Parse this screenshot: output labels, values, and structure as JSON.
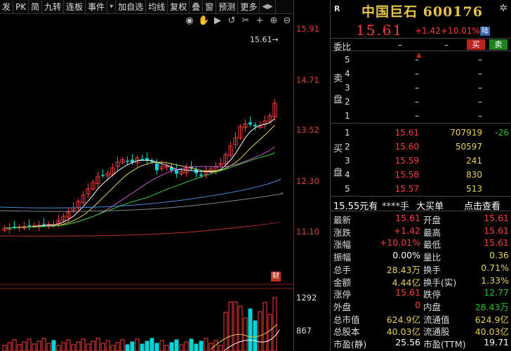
{
  "toolbar": {
    "items": [
      "发",
      "PK",
      "简",
      "九转",
      "连板",
      "事件",
      "▾",
      "加自选",
      "均线",
      "复权",
      "叠",
      "窗",
      "预测",
      "更多",
      "◀▶"
    ]
  },
  "chart": {
    "price_axis": [
      "15.91",
      "14.71",
      "13.52",
      "12.30",
      "11.10"
    ],
    "current_price_marker": "15.61→",
    "volume_axis": [
      "1292",
      "867"
    ],
    "marker_badge": "财",
    "tool_icons": [
      "eye-icon",
      "hand-icon",
      "play-icon",
      "undo-icon",
      "scissors-icon",
      "plus-icon",
      "zoom-in-icon",
      "zoom-out-icon"
    ],
    "colors": {
      "up": "#ff3b3b",
      "down": "#00d4d4",
      "ma5": "#ffffff",
      "ma10": "#e6d24a",
      "ma20": "#cc55cc",
      "ma30": "#33cc33",
      "ma60": "#4a8ad8",
      "ma120": "#888888",
      "ma250": "#c03030"
    }
  },
  "quote": {
    "badge": "R",
    "title": "中国巨石 600176",
    "price": "15.61",
    "change": "+1.42",
    "change_pct": "+10.01%",
    "exchange_badge": "陆"
  },
  "weibi": {
    "label": "委比",
    "v1": "–",
    "v2": "–",
    "buy": "买",
    "sell": "卖",
    "collapse": "▲"
  },
  "asks": {
    "label": [
      "卖",
      "盘"
    ],
    "rows": [
      {
        "level": "5",
        "price": "–",
        "vol": "–"
      },
      {
        "level": "4",
        "price": "–",
        "vol": "–"
      },
      {
        "level": "3",
        "price": "–",
        "vol": "–"
      },
      {
        "level": "2",
        "price": "–",
        "vol": "–"
      },
      {
        "level": "1",
        "price": "–",
        "vol": "–"
      }
    ]
  },
  "bids": {
    "label": [
      "买",
      "盘"
    ],
    "rows": [
      {
        "level": "1",
        "price": "15.61",
        "vol": "707919",
        "extra": "-26"
      },
      {
        "level": "2",
        "price": "15.60",
        "vol": "50597",
        "extra": ""
      },
      {
        "level": "3",
        "price": "15.59",
        "vol": "241",
        "extra": ""
      },
      {
        "level": "4",
        "price": "15.58",
        "vol": "830",
        "extra": ""
      },
      {
        "level": "5",
        "price": "15.57",
        "vol": "513",
        "extra": ""
      }
    ]
  },
  "deal": {
    "price": "15.55元有",
    "vol": "****手",
    "big": "大买单",
    "view": "点击查看"
  },
  "stats": [
    {
      "l1": "最新",
      "v1": "15.61",
      "c1": "red",
      "l2": "开盘",
      "v2": "15.61",
      "c2": "red"
    },
    {
      "l1": "涨跌",
      "v1": "+1.42",
      "c1": "red",
      "l2": "最高",
      "v2": "15.61",
      "c2": "red"
    },
    {
      "l1": "涨幅",
      "v1": "+10.01%",
      "c1": "red",
      "l2": "最低",
      "v2": "15.61",
      "c2": "red"
    },
    {
      "l1": "振幅",
      "v1": "0.00%",
      "c1": "white",
      "l2": "量比",
      "v2": "0.36",
      "c2": "yellow"
    },
    {
      "l1": "总手",
      "v1": "28.43万",
      "c1": "yellow",
      "l2": "换手",
      "v2": "0.71%",
      "c2": "yellow"
    },
    {
      "l1": "金额",
      "v1": "4.44亿",
      "c1": "yellow",
      "l2": "换手(实)",
      "v2": "1.33%",
      "c2": "yellow"
    },
    {
      "l1": "涨停",
      "v1": "15.61",
      "c1": "red",
      "l2": "跌停",
      "v2": "12.77",
      "c2": "green"
    },
    {
      "l1": "外盘",
      "v1": "0",
      "c1": "red",
      "l2": "内盘",
      "v2": "28.43万",
      "c2": "green"
    },
    {
      "l1": "总市值",
      "v1": "624.9亿",
      "c1": "yellow",
      "l2": "流通值",
      "v2": "624.9亿",
      "c2": "yellow"
    },
    {
      "l1": "总股本",
      "v1": "40.03亿",
      "c1": "yellow",
      "l2": "流通股",
      "v2": "40.03亿",
      "c2": "yellow"
    },
    {
      "l1": "市盈(静)",
      "v1": "25.56",
      "c1": "white",
      "l2": "市盈(TTM)",
      "v2": "19.71",
      "c2": "white"
    }
  ]
}
